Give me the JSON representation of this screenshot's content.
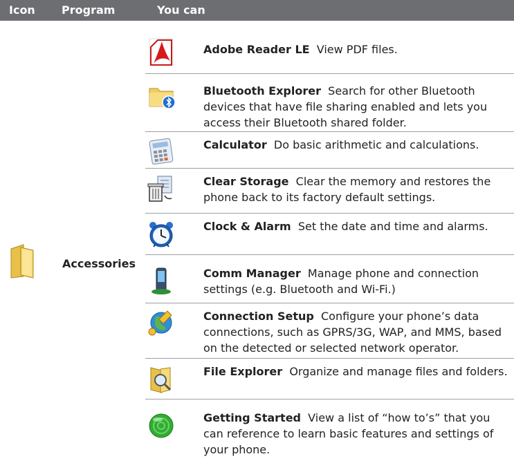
{
  "header": {
    "col_icon": "Icon",
    "col_program": "Program",
    "col_you_can": "You can"
  },
  "group": {
    "program": "Accessories"
  },
  "rows": [
    {
      "name": "Adobe Reader LE",
      "desc": "View PDF files."
    },
    {
      "name": "Bluetooth Explorer",
      "desc": "Search for other Bluetooth devices that have file sharing enabled and lets you access their Bluetooth shared folder."
    },
    {
      "name": "Calculator",
      "desc": "Do basic arithmetic and calculations."
    },
    {
      "name": "Clear Storage",
      "desc": "Clear the memory and restores the phone back to its factory default settings."
    },
    {
      "name": "Clock & Alarm",
      "desc": "Set the date and time and alarms."
    },
    {
      "name": "Comm Manager",
      "desc": "Manage phone and connection settings (e.g. Bluetooth and Wi-Fi.)"
    },
    {
      "name": "Connection Setup",
      "desc": "Configure your phone’s data connections, such as GPRS/3G, WAP, and MMS, based on the detected or selected network operator."
    },
    {
      "name": "File Explorer",
      "desc": "Organize and manage files and folders."
    },
    {
      "name": "Getting Started",
      "desc": "View a list of “how to’s” that you can reference to learn basic features and settings of your phone."
    }
  ],
  "icons": [
    "folder-icon",
    "adobe-reader-icon",
    "bluetooth-folder-icon",
    "calculator-icon",
    "clear-storage-icon",
    "alarm-clock-icon",
    "comm-manager-icon",
    "connection-setup-icon",
    "file-explorer-icon",
    "getting-started-icon"
  ]
}
